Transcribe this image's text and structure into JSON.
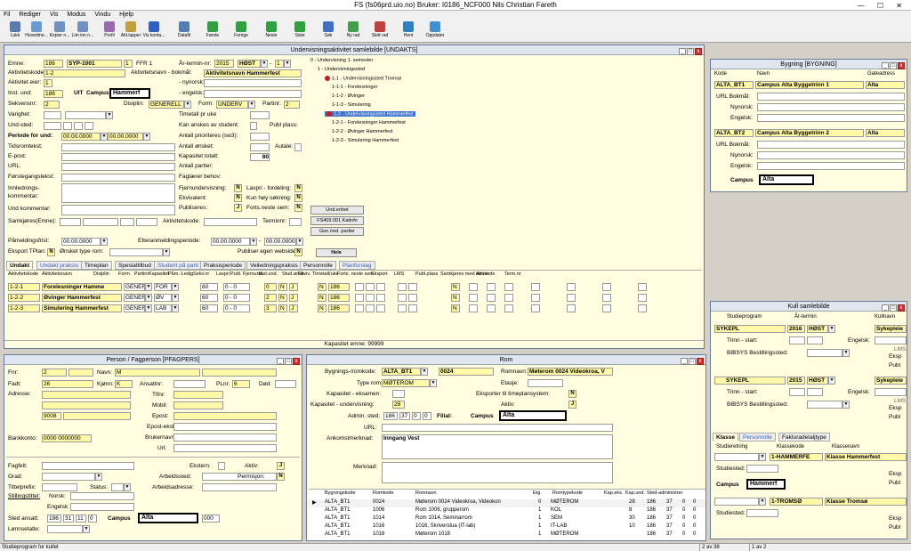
{
  "app": {
    "title": "FS (fs06prd.uio.no) Bruker: I0186_NCF000 Nils Christian Fareth",
    "menu": [
      "Fil",
      "Rediger",
      "Vis",
      "Modus",
      "Vindu",
      "Hjelp"
    ],
    "toolbar": [
      "Lukk",
      "Hovedme...",
      "Kopier n...",
      "Lim inn n...",
      "Profil",
      "Akt.lapper",
      "Vis konta...",
      "Datafil",
      "Første",
      "Forrige",
      "Neste",
      "Siste",
      "Søk",
      "Ny rad",
      "Slett rad",
      "Hent",
      "Oppdater"
    ],
    "toolbar_colors": [
      "#5a7ab0",
      "#6a9ad0",
      "#7090c0",
      "#7090c0",
      "#9a6ab0",
      "#c0a040",
      "#3060c0",
      "#5080b0",
      "#30a040",
      "#30a040",
      "#30a040",
      "#30a040",
      "#4070c0",
      "#40a050",
      "#c04040",
      "#3080c0",
      "#4090d0"
    ]
  },
  "undakts": {
    "title": "Undervisningsaktivitet samlebilde   [UNDAKTS]",
    "labels": {
      "emne": "Emne:",
      "aktivitetskode": "Aktivitetskode",
      "aktivitet_eier": "Aktivitet eier:",
      "inst_und": "Inst. und:",
      "sekvensnr": "Sekvensnr:",
      "varighet": "Varighet:",
      "und_sted": "Und-sted:",
      "periode": "Periode for und:",
      "tidsromtekst": "Tidsromtekst:",
      "epost": "E-post:",
      "url": "URL:",
      "forstegang": "Førstegangstekst:",
      "innledning": "Innlednings-",
      "kommentar": "kommentar:",
      "und_kommentar": "Und kommentar:",
      "samkjores": "Samkjøres(Emne):",
      "aktivitetskode2": "Aktivitetskode:",
      "terminnr": "Terminnr:",
      "pameldingsfrist": "Påmeldingsfrist:",
      "etteranmelding": "Etteranmeldingsperiode:",
      "eksport_tplan": "Eksport TPlan:",
      "onsket_type_rom": "Ønsket type rom:",
      "publiser_egen": "Publiser egen webside",
      "ar_termin": "År-termin-nr:",
      "aktivitetsnavn_bokmal": "Aktivitetsnavn - bokmål:",
      "nynorsk": "- nynorsk:",
      "engelsk": "- engelsk:",
      "disiplin": "Disiplin:",
      "form": "Form:",
      "partinr": "Partinr:",
      "timetall_pr_uke": "Timetall pr uke",
      "kan_anskes": "Kan anskes av student:",
      "publ_plass": "Publ plass:",
      "antall_prioriteres": "Antall prioriteres (sw3):",
      "antall_onsket": "Antall ønsket:",
      "autale": "Autale:",
      "kapasitet_totalt": "Kapasitet totalt:",
      "antall_partier": "Antall partier:",
      "faglaerer_behov": "Faglærer behov:",
      "fjernundervisning": "Fjernundervisning:",
      "lavpri_fordeling": "Lavpri - fordeling:",
      "ekvivalent": "Ekvivalent:",
      "kun_hoy_sokning": "Kun høy søkning:",
      "publiseres": "Publiseres:",
      "forts_neste_sem": "Forts.neste sem:"
    },
    "values": {
      "emne_a": "186",
      "emne_b": "SYP-1001",
      "emne_c": "1",
      "emne_d": "FFR 1",
      "aktivitetskode": "1-2",
      "aktivitet_eier": "1",
      "inst_und": "186",
      "inst_und_name": "UIT",
      "campus_label": "Campus",
      "campus_value": "Hammerf",
      "sekvensnr": "2",
      "periode_from": "00.00.0000",
      "periode_to": "00.00.0000",
      "ar": "2015",
      "termin": "HØST",
      "termin_nr": "1",
      "aktivitetsnavn": "Aktivitetsnavn Hammerfest",
      "disiplin": "GENERELL",
      "form": "UNDERV",
      "partinr": "2",
      "kapasitet_totalt": "80",
      "fjernundervisning": "N",
      "lavpri_fordeling": "N",
      "ekvivalent": "N",
      "kun_hoy_sokning": "N",
      "publiseres": "J",
      "forts_neste_sem": "N",
      "pameldingsfrist": "00.00.0000",
      "etter_from": "00.00.0000",
      "etter_to": "00.00.0000",
      "eksport_tplan": "N",
      "publiser_egen": "N"
    },
    "tree": [
      {
        "text": "0 - Undervisning 1. semester",
        "indent": 0
      },
      {
        "text": "1 - Undervisningssted",
        "indent": 1
      },
      {
        "text": "1-1 - Undervisningssted Tromsø",
        "indent": 2
      },
      {
        "text": "1-1-1 - Forelesninger",
        "indent": 3
      },
      {
        "text": "1-1-2 - Øvinger",
        "indent": 3
      },
      {
        "text": "1-1-3 - Simulering",
        "indent": 3
      },
      {
        "text": "1-2 - Undervisningssted Hammerfest",
        "indent": 2,
        "selected": true
      },
      {
        "text": "1-2-1 - Forelesninger Hammerfest",
        "indent": 3
      },
      {
        "text": "1-2-2 - Øvinger Hammerfest",
        "indent": 3
      },
      {
        "text": "1-2-3 - Simulering Hammerfest",
        "indent": 3
      }
    ],
    "buttons": [
      "Und.enhet",
      "FS409.001 Katinfo",
      "Gen./red. partier",
      "Hele"
    ],
    "tabs": [
      {
        "label": "Undakt",
        "active": true
      },
      {
        "label": "Undakt praksis",
        "blue": true
      },
      {
        "label": "Timeplan"
      },
      {
        "label": "Spesialtilbud"
      },
      {
        "label": "Student på parti",
        "blue": true
      },
      {
        "label": "Praksisperiode"
      },
      {
        "label": "Veiledningspraksis"
      },
      {
        "label": "Personrolle"
      },
      {
        "label": "Planforslag",
        "blue": true
      }
    ],
    "grid_headers": [
      "Aktivitetskode",
      "Aktivitetsnavn",
      "Disiplin",
      "Form",
      "Partinr",
      "Kapasitet",
      "Påm.-Ledig",
      "Sekv.nr",
      "Lavpri",
      "Publ.",
      "Fjernund.",
      "Inst.und.",
      "Stud.ønsk.",
      "Ekviv.",
      "Timetall/uke",
      "Forts. neste sem",
      "Eksport",
      "LMS",
      "Publ.plass",
      "Samkjøres med emne",
      "Akt.kode",
      "Term.nr"
    ],
    "rows": [
      {
        "kode": "1-2-1",
        "navn": "Forelesninger Hamme",
        "disiplin": "GENER",
        "form": "FOR",
        "kap": "60",
        "pam": "0 - 0",
        "sekv": "0",
        "lavpri": "N",
        "publ": "J",
        "fjern": "N",
        "inst": "186",
        "forts": "N"
      },
      {
        "kode": "1-2-2",
        "navn": "Øvinger Hammerfest",
        "disiplin": "GENER",
        "form": "ØV",
        "kap": "60",
        "pam": "0 - 0",
        "sekv": "2",
        "lavpri": "N",
        "publ": "J",
        "fjern": "N",
        "inst": "186",
        "forts": "N"
      },
      {
        "kode": "1-2-3",
        "navn": "Simulering Hammerfest",
        "disiplin": "GENER",
        "form": "LAB",
        "kap": "60",
        "pam": "0 - 0",
        "sekv": "3",
        "lavpri": "N",
        "publ": "J",
        "fjern": "N",
        "inst": "186",
        "forts": "N"
      }
    ],
    "footer": "Kapasitet emne: 99999"
  },
  "bygning": {
    "title": "Bygning  [BYGNING]",
    "headers": [
      "Kode",
      "Navn",
      "Gateadress"
    ],
    "entries": [
      {
        "kode": "ALTA_BT1",
        "navn": "Campus Alta Byggetrinn 1",
        "gate": "Alta"
      },
      {
        "kode": "ALTA_BT2",
        "navn": "Campus Alta Byggetrinn 2",
        "gate": "Alta"
      }
    ],
    "labels": [
      "URL Bokmål:",
      "Nynorsk:",
      "Engelsk:"
    ],
    "campus_label": "Campus",
    "campus_value": "Alta"
  },
  "kull": {
    "title": "Kull samlebilde",
    "headers": [
      "Studieprogram",
      "År-termin",
      "Kullnavn"
    ],
    "entries": [
      {
        "program": "SYKEPL",
        "ar": "2016",
        "termin": "HØST",
        "navn": "Sykepleie"
      },
      {
        "program": "SYKEPL",
        "ar": "2015",
        "termin": "HØST",
        "navn": "Sykepleie"
      }
    ],
    "labels": {
      "trinn": "Trinn - start:",
      "engelsk": "Engelsk:",
      "bibsys": "BIBSYS Bestillingssted:",
      "lms": "LMS",
      "eksp": "Eksp",
      "publ": "Publ"
    },
    "tabs": [
      "Klasse",
      "Personrolle",
      "Fakturadetaljtype"
    ],
    "klasse_headers": [
      "Studieretning",
      "Klassekode",
      "Klassenavn"
    ],
    "klasser": [
      {
        "kode": "1-HAMMERFE",
        "navn": "Klasse Hammerfest"
      },
      {
        "kode": "1-TROMSØ",
        "navn": "Klasse Tromsø"
      }
    ],
    "studiested": "Studiested:",
    "campus_label": "Campus",
    "campus_value": "Hammerf"
  },
  "person": {
    "title": "Person / Fagperson   [PFAGPERS]",
    "labels": {
      "fnr": "Fnr:",
      "fadt": "Fadt:",
      "adresse": "Adresse:",
      "navn": "Navn:",
      "kjonn": "Kjønn:",
      "ansattnr": "Ansattnr:",
      "tlfnr": "Tlfnr:",
      "mobil": "Mobil:",
      "epost": "Epost:",
      "epost_ekst": "Epost-ekst.:",
      "brukernavn": "Brukernavn:",
      "url": "Url:",
      "plnr": "PLnr:",
      "dod": "Død:",
      "bankkonto": "Bankkonto:",
      "fagfelt": "Fagfelt:",
      "grad": "Grad:",
      "tittelprefix": "Tittelprefix:",
      "status": "Status:",
      "stillingstittel": "Stillingstittel:",
      "norsk": "Norsk:",
      "engelsk": "Engelsk:",
      "arbeidssted": "Arbeidssted:",
      "arbeidsadresse": "Arbeidsadresse:",
      "ekstern": "Ekstern:",
      "aktiv": "Aktiv:",
      "permisjon": "Permisjon:",
      "sted_ansatt": "Sted ansatt:",
      "lonnsetatle": "Lønnsetatle:"
    },
    "values": {
      "fnr": "2",
      "fadt": "26",
      "navn": "M",
      "kjonn": "K",
      "plnr": "6",
      "postnr": "9008",
      "bankkonto": "0000 0000000",
      "aktiv": "J",
      "permisjon": "N",
      "sted_a": "186",
      "sted_b": "31",
      "sted_c": "11",
      "sted_d": "0",
      "sted_e": "000"
    },
    "campus_label": "Campus",
    "campus_value": "Alta"
  },
  "rom": {
    "title": "Rom",
    "labels": {
      "bygning_romkode": "Bygnings-/romkode:",
      "romnavn": "Romnavn:",
      "type_rom": "Type rom:",
      "etasje": "Etasje:",
      "kap_eksamen": "Kapasitet - eksamen:",
      "kap_undervisning": "Kapasitet - undervisning:",
      "eksporter": "Eksporter til timeplansystem:",
      "admin_sted": "Admin. sted:",
      "filial": "Filial:",
      "aktiv": "Aktiv:",
      "url": "URL:",
      "ankomstmerknad": "Ankomstmerknad:",
      "merknad": "Merknad:"
    },
    "values": {
      "bygning": "ALTA_BT1",
      "romkode": "0024",
      "romnavn": "Møterom 0024 Videokroa, V",
      "type_rom": "MØTEROM",
      "kap_undervisning": "28",
      "eksporter": "N",
      "aktiv": "J",
      "admin_a": "186",
      "admin_b": "37",
      "admin_c": "0",
      "admin_d": "0",
      "ankomstmerknad": "Inngang Vest"
    },
    "campus_label": "Campus",
    "campus_value": "Alta",
    "grid_headers": [
      "Bygningskode",
      "Romkode",
      "Romnavn",
      "Etg.",
      "Romtypekode",
      "Kap.eks.",
      "Kap.und.",
      "Sted-administrer"
    ],
    "rows": [
      {
        "byg": "ALTA_BT1",
        "rom": "0024",
        "navn": "Møterom 0024 Videokroa, Videokon",
        "etg": "0",
        "type": "MØTEROM",
        "kapeks": "",
        "kapund": "28",
        "a": "186",
        "b": "37",
        "c": "0",
        "d": "0"
      },
      {
        "byg": "ALTA_BT1",
        "rom": "1006",
        "navn": "Rom 1006, grupperom",
        "etg": "1",
        "type": "KOL",
        "kapeks": "",
        "kapund": "8",
        "a": "186",
        "b": "37",
        "c": "0",
        "d": "0"
      },
      {
        "byg": "ALTA_BT1",
        "rom": "1014",
        "navn": "Rom 1014, Seminarrom",
        "etg": "1",
        "type": "SEM",
        "kapeks": "",
        "kapund": "30",
        "a": "186",
        "b": "37",
        "c": "0",
        "d": "0"
      },
      {
        "byg": "ALTA_BT1",
        "rom": "1016",
        "navn": "1016, Skriverstua (IT-lab)",
        "etg": "1",
        "type": "IT-LAB",
        "kapeks": "",
        "kapund": "10",
        "a": "186",
        "b": "37",
        "c": "0",
        "d": "0"
      },
      {
        "byg": "ALTA_BT1",
        "rom": "1018",
        "navn": "Møterom 1018",
        "etg": "1",
        "type": "MØTEROM",
        "kapeks": "",
        "kapund": "",
        "a": "186",
        "b": "37",
        "c": "0",
        "d": "0"
      }
    ]
  },
  "status": {
    "left": "Studieprogram for kullet",
    "rec": "2 av 38",
    "rec2": "1 av 2"
  }
}
